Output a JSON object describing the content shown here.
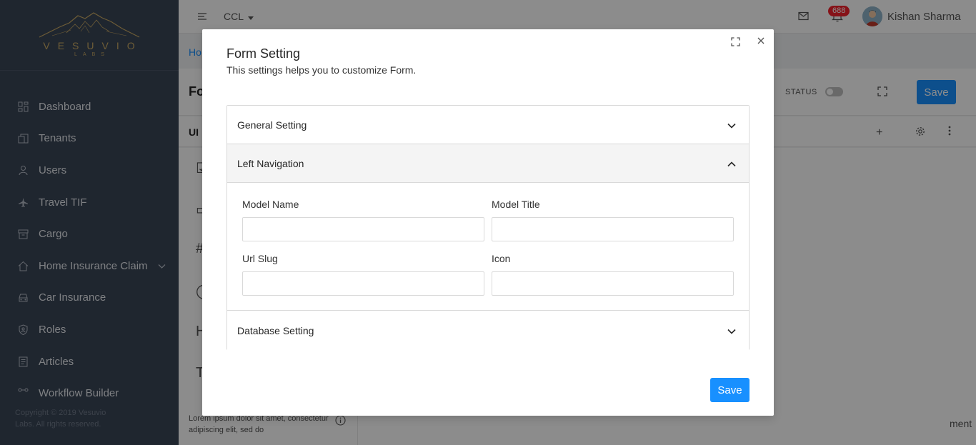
{
  "logo": {
    "text": "VESUVIO",
    "subtext": "LABS"
  },
  "sidebar": {
    "items": [
      {
        "label": "Dashboard",
        "icon": "dashboard-icon"
      },
      {
        "label": "Tenants",
        "icon": "building-icon"
      },
      {
        "label": "Users",
        "icon": "user-icon"
      },
      {
        "label": "Travel TIF",
        "icon": "airplane-icon"
      },
      {
        "label": "Cargo",
        "icon": "box-icon"
      },
      {
        "label": "Home Insurance Claim",
        "icon": "home-icon"
      },
      {
        "label": "Car Insurance",
        "icon": "car-icon"
      },
      {
        "label": "Roles",
        "icon": "shield-icon"
      },
      {
        "label": "Articles",
        "icon": "article-icon"
      },
      {
        "label": "Workflow Builder",
        "icon": "workflow-icon"
      }
    ],
    "copyright": "Copyright © 2019 Vesuvio Labs. All rights reserved."
  },
  "header": {
    "tenant": "CCL",
    "notification_count": "688",
    "user_name": "Kishan Sharma"
  },
  "page": {
    "breadcrumb": "Ho",
    "title": "Fo",
    "status_label": "STATUS",
    "save_label": "Save",
    "tab_label": "UI",
    "lp_glyphs": [
      "☑",
      "▭",
      "#",
      "◯",
      "H",
      "T"
    ],
    "lp_footer": "Lorem ipsum dolor sit amet, consectetur adipiscing elit, sed do",
    "canvas_text": "ment"
  },
  "modal": {
    "title": "Form Setting",
    "subtitle": "This settings helps you to customize Form.",
    "panels": {
      "general": "General Setting",
      "left_nav": "Left Navigation",
      "database": "Database Setting"
    },
    "fields": {
      "model_name": {
        "label": "Model Name",
        "value": ""
      },
      "model_title": {
        "label": "Model Title",
        "value": ""
      },
      "url_slug": {
        "label": "Url Slug",
        "value": ""
      },
      "icon": {
        "label": "Icon",
        "value": ""
      }
    },
    "save_label": "Save"
  },
  "colors": {
    "sidebar": "#3a4556",
    "accent": "#1890ff",
    "logo_gold": "#c8a964",
    "badge": "#f5222d"
  }
}
